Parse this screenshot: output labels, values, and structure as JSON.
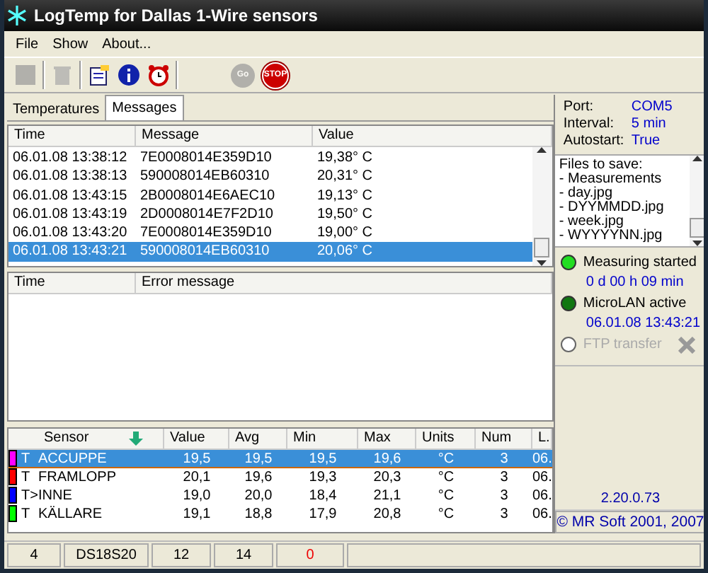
{
  "window": {
    "title": "LogTemp for Dallas 1-Wire sensors"
  },
  "menu": [
    "File",
    "Show",
    "About..."
  ],
  "toolbar": [
    {
      "kind": "square",
      "disabled": true
    },
    {
      "kind": "trash",
      "disabled": true
    },
    {
      "kind": "clipboard",
      "disabled": false
    },
    {
      "kind": "info",
      "disabled": false
    },
    {
      "kind": "alarm",
      "disabled": false
    },
    {
      "kind": "go",
      "label": "Go",
      "disabled": true
    },
    {
      "kind": "stop",
      "label": "STOP",
      "disabled": false
    }
  ],
  "tabs": [
    {
      "label": "Temperatures",
      "selected": false
    },
    {
      "label": "Messages",
      "selected": true
    }
  ],
  "messages": {
    "columns": [
      "Time",
      "Message",
      "Value"
    ],
    "rows": [
      {
        "time": "06.01.08 13:38:12",
        "message": "7E0008014E359D10",
        "value": "19,38° C",
        "selected": false
      },
      {
        "time": "06.01.08 13:38:13",
        "message": "590008014EB60310",
        "value": "20,31° C",
        "selected": false
      },
      {
        "time": "06.01.08 13:43:15",
        "message": "2B0008014E6AEC10",
        "value": "19,13° C",
        "selected": false
      },
      {
        "time": "06.01.08 13:43:19",
        "message": "2D0008014E7F2D10",
        "value": "19,50° C",
        "selected": false
      },
      {
        "time": "06.01.08 13:43:20",
        "message": "7E0008014E359D10",
        "value": "19,00° C",
        "selected": false
      },
      {
        "time": "06.01.08 13:43:21",
        "message": "590008014EB60310",
        "value": "20,06° C",
        "selected": true
      }
    ]
  },
  "errors": {
    "columns": [
      "Time",
      "Error message"
    ]
  },
  "sensors": {
    "columns": [
      "Sensor",
      "Value",
      "Avg",
      "Min",
      "Max",
      "Units",
      "Num",
      "L."
    ],
    "rows": [
      {
        "color": "#ff00ff",
        "prefix": "T",
        "name": "ACCUPPE",
        "value": "19,5",
        "avg": "19,5",
        "min": "19,5",
        "max": "19,6",
        "units": "°C",
        "num": "3",
        "last": "06.",
        "selected": true
      },
      {
        "color": "#ff0000",
        "prefix": "T",
        "name": "FRAMLOPP",
        "value": "20,1",
        "avg": "19,6",
        "min": "19,3",
        "max": "20,3",
        "units": "°C",
        "num": "3",
        "last": "06.",
        "selected": false
      },
      {
        "color": "#0000ff",
        "prefix": "T>",
        "name": "INNE",
        "value": "19,0",
        "avg": "20,0",
        "min": "18,4",
        "max": "21,1",
        "units": "°C",
        "num": "3",
        "last": "06.",
        "selected": false
      },
      {
        "color": "#00ff00",
        "prefix": "T",
        "name": "KÄLLARE",
        "value": "19,1",
        "avg": "18,8",
        "min": "17,9",
        "max": "20,8",
        "units": "°C",
        "num": "3",
        "last": "06.",
        "selected": false
      }
    ]
  },
  "settings": [
    {
      "label": "Port:",
      "value": "COM5"
    },
    {
      "label": "Interval:",
      "value": "5 min"
    },
    {
      "label": "Autostart:",
      "value": "True"
    }
  ],
  "files": [
    "Files to save:",
    "- Measurements",
    "- day.jpg",
    "- DYYMMDD.jpg",
    "- week.jpg",
    "- WYYYYNN.jpg"
  ],
  "lights": [
    {
      "label": "Measuring started",
      "detail": "0 d 00 h 09 min",
      "on": true,
      "color": "#22dd22"
    },
    {
      "label": "MicroLAN active",
      "detail": "06.01.08 13:43:21",
      "on": true,
      "color": "#117711"
    },
    {
      "label": "FTP transfer",
      "on": false,
      "color": "#ffffff"
    }
  ],
  "version": "2.20.0.73",
  "copyright": "© MR Soft 2001, 2007",
  "status_bar": [
    {
      "text": "4",
      "alert": false
    },
    {
      "text": "DS18S20",
      "alert": false
    },
    {
      "text": "12",
      "alert": false
    },
    {
      "text": "14",
      "alert": false
    },
    {
      "text": "0",
      "alert": true
    }
  ]
}
